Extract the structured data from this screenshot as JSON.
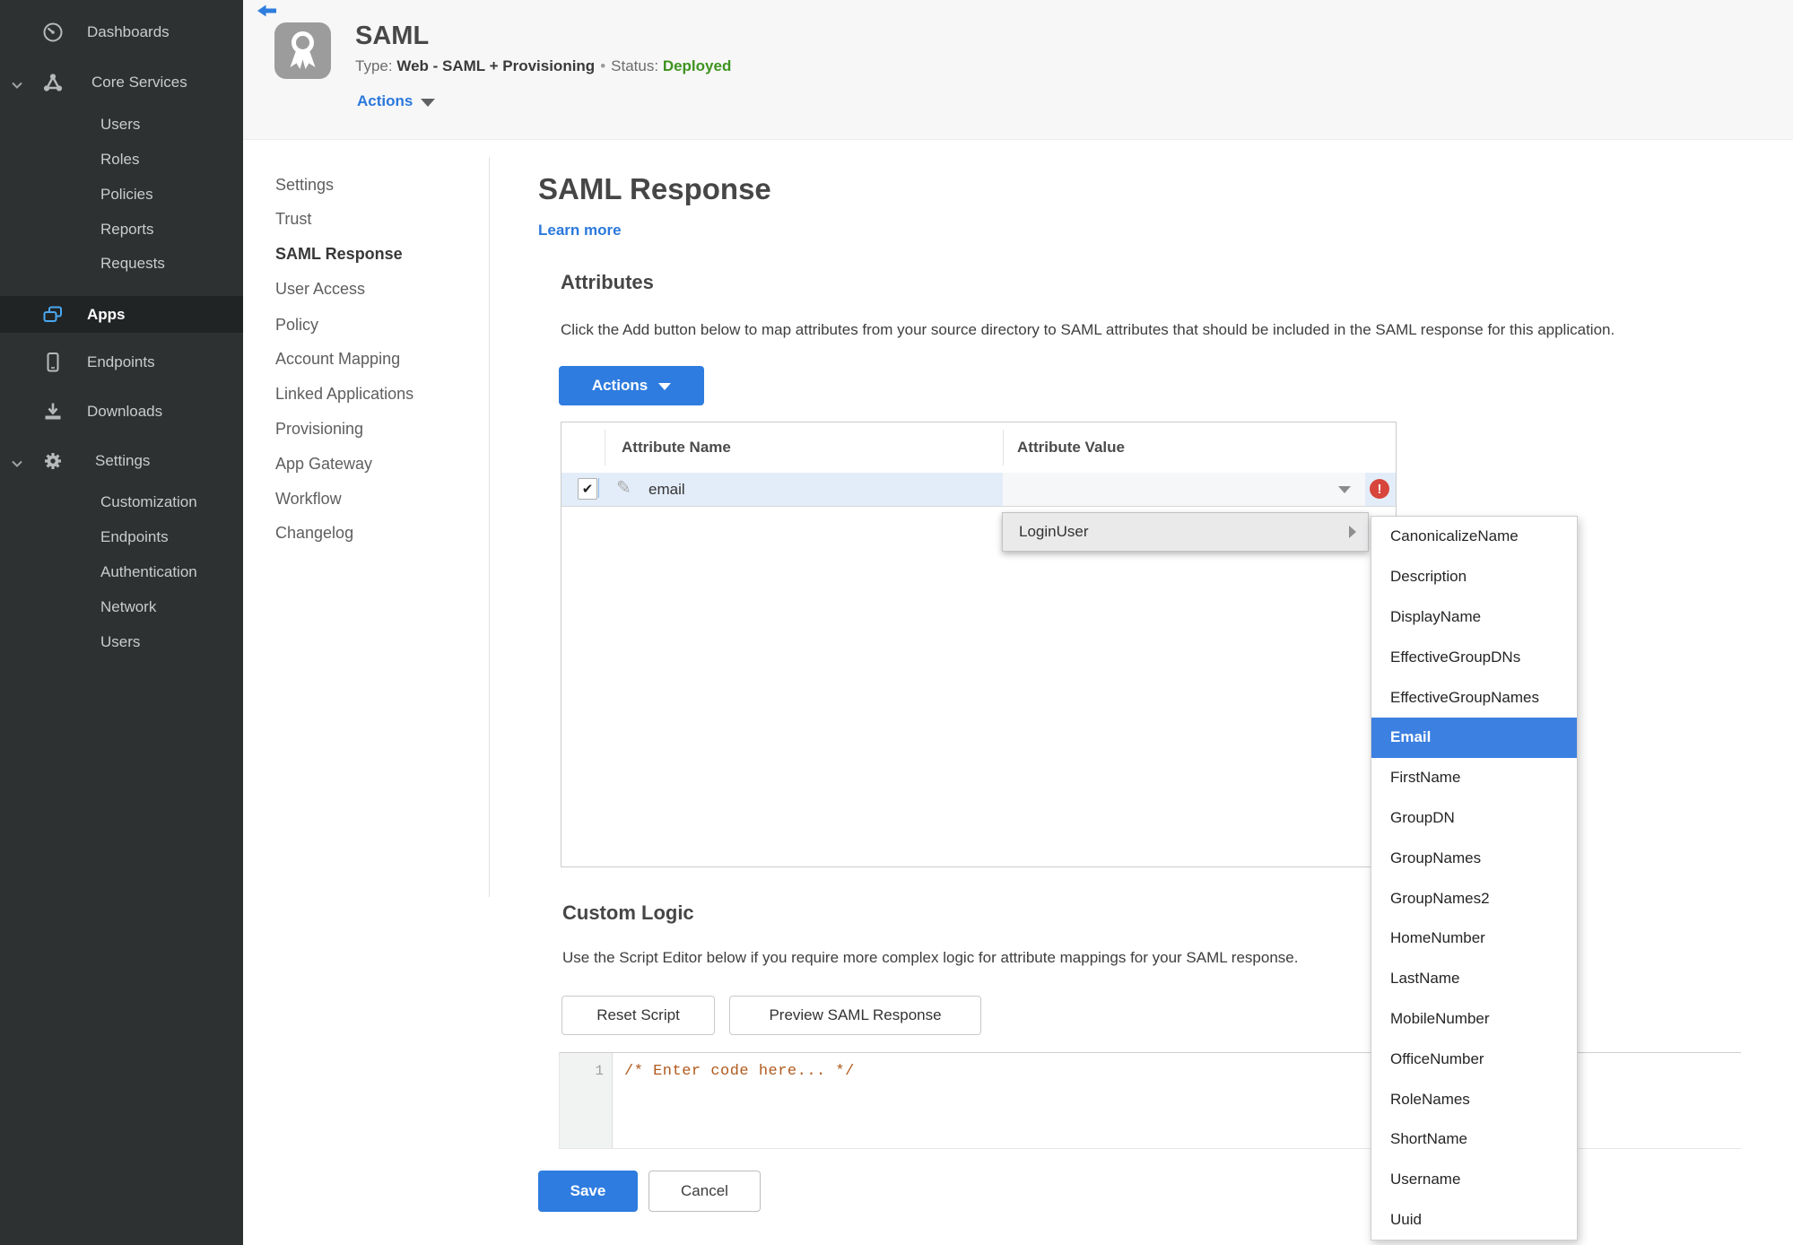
{
  "colors": {
    "accent_blue": "#2e7cdf",
    "link_blue": "#2b78dc",
    "status_green": "#3f9320",
    "error_red": "#d8453c",
    "selection_blue": "#3c80e2",
    "code_orange": "#b05a1e",
    "sidebar_bg": "#2e3132",
    "sidebar_active_bg": "#212425",
    "row_highlight": "#e3edf9"
  },
  "icons": {
    "edit": "✎",
    "check": "✔",
    "error": "!"
  },
  "sidebar": {
    "items": [
      {
        "label": "Dashboards",
        "icon": "gauge-icon",
        "level": 0,
        "active": false
      },
      {
        "label": "Core Services",
        "icon": "core-services-icon",
        "level": 0,
        "active": false,
        "expanded": true
      },
      {
        "label": "Users",
        "level": 1,
        "active": false
      },
      {
        "label": "Roles",
        "level": 1,
        "active": false
      },
      {
        "label": "Policies",
        "level": 1,
        "active": false
      },
      {
        "label": "Reports",
        "level": 1,
        "active": false
      },
      {
        "label": "Requests",
        "level": 1,
        "active": false
      },
      {
        "label": "Apps",
        "icon": "apps-icon",
        "level": 0,
        "active": true
      },
      {
        "label": "Endpoints",
        "icon": "smartphone-icon",
        "level": 0,
        "active": false
      },
      {
        "label": "Downloads",
        "icon": "download-icon",
        "level": 0,
        "active": false
      },
      {
        "label": "Settings",
        "icon": "gear-icon",
        "level": 0,
        "active": false,
        "expanded": true
      },
      {
        "label": "Customization",
        "level": 1,
        "active": false
      },
      {
        "label": "Endpoints",
        "level": 1,
        "active": false
      },
      {
        "label": "Authentication",
        "level": 1,
        "active": false
      },
      {
        "label": "Network",
        "level": 1,
        "active": false
      },
      {
        "label": "Users",
        "level": 1,
        "active": false
      }
    ]
  },
  "header": {
    "title": "SAML",
    "type_label": "Type:",
    "type_value": "Web - SAML + Provisioning",
    "separator": "•",
    "status_label": "Status:",
    "status_value": "Deployed",
    "actions_label": "Actions"
  },
  "subnav": {
    "items": [
      {
        "label": "Settings",
        "active": false
      },
      {
        "label": "Trust",
        "active": false
      },
      {
        "label": "SAML Response",
        "active": true
      },
      {
        "label": "User Access",
        "active": false
      },
      {
        "label": "Policy",
        "active": false
      },
      {
        "label": "Account Mapping",
        "active": false
      },
      {
        "label": "Linked Applications",
        "active": false
      },
      {
        "label": "Provisioning",
        "active": false
      },
      {
        "label": "App Gateway",
        "active": false
      },
      {
        "label": "Workflow",
        "active": false
      },
      {
        "label": "Changelog",
        "active": false
      }
    ]
  },
  "main": {
    "title": "SAML Response",
    "learn_more": "Learn more",
    "attributes": {
      "heading": "Attributes",
      "description": "Click the Add button below to map attributes from your source directory to SAML attributes that should be included in the SAML response for this application.",
      "actions_label": "Actions"
    },
    "table": {
      "col_name": "Attribute Name",
      "col_value": "Attribute Value",
      "row": {
        "name": "email",
        "value": "",
        "checked": true,
        "has_error": true
      }
    },
    "value_menu": {
      "label": "LoginUser",
      "selected": "Email",
      "items": [
        "CanonicalizeName",
        "Description",
        "DisplayName",
        "EffectiveGroupDNs",
        "EffectiveGroupNames",
        "Email",
        "FirstName",
        "GroupDN",
        "GroupNames",
        "GroupNames2",
        "HomeNumber",
        "LastName",
        "MobileNumber",
        "OfficeNumber",
        "RoleNames",
        "ShortName",
        "Username",
        "Uuid"
      ]
    },
    "custom_logic": {
      "heading": "Custom Logic",
      "description": "Use the Script Editor below if you require more complex logic for attribute mappings for your SAML response.",
      "reset_label": "Reset Script",
      "preview_label": "Preview SAML Response",
      "editor": {
        "line_number": "1",
        "code": "/* Enter code here... */"
      }
    },
    "footer": {
      "save_label": "Save",
      "cancel_label": "Cancel"
    }
  }
}
